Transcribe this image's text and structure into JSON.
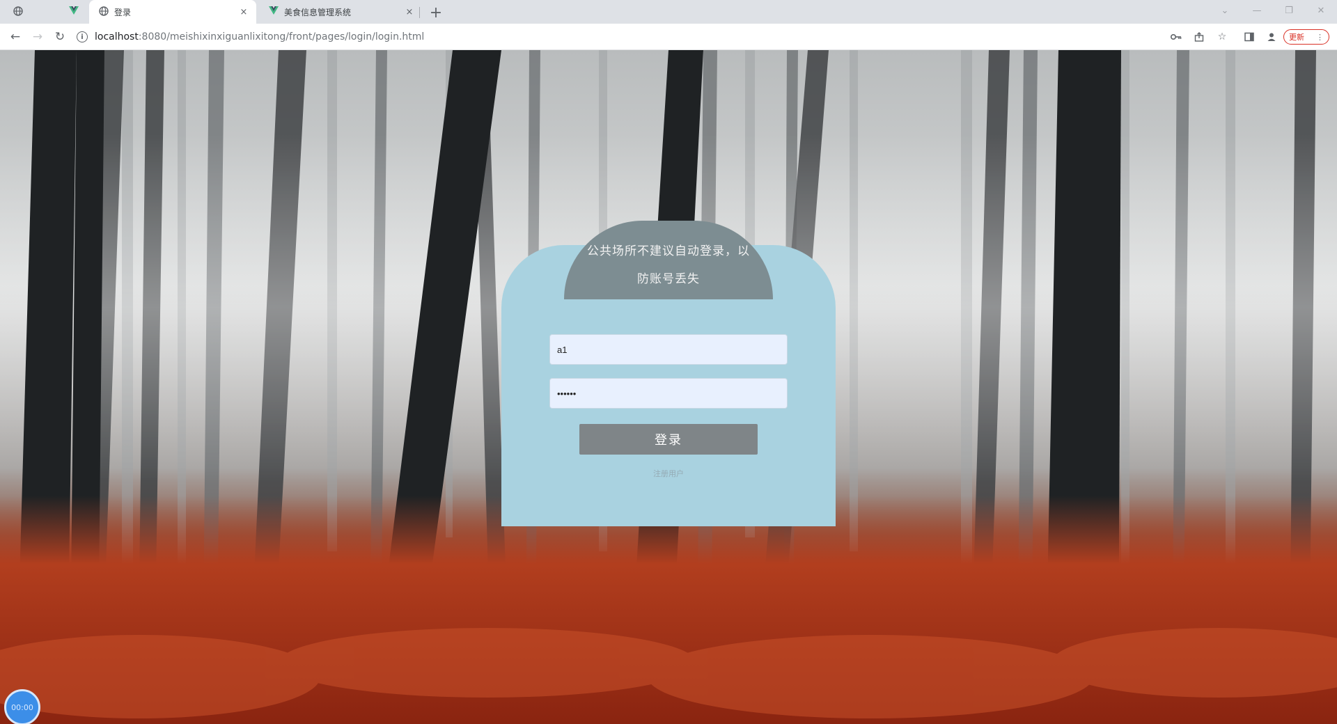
{
  "browser": {
    "tabs": [
      {
        "title": "",
        "pinned": true,
        "icon": "globe-icon"
      },
      {
        "title": "",
        "pinned": true,
        "icon": "blank-icon"
      },
      {
        "title": "",
        "pinned": true,
        "icon": "vue-icon"
      },
      {
        "title": "登录",
        "active": true,
        "icon": "globe-icon"
      },
      {
        "title": "美食信息管理系统",
        "active": false,
        "icon": "vue-icon"
      }
    ],
    "close_glyph": "×",
    "newtab_glyph": "+",
    "address": {
      "host": "localhost",
      "path": ":8080/meishixinxiguanlixitong/front/pages/login/login.html"
    },
    "update_label": "更新",
    "update_menu_glyph": "⋮"
  },
  "login": {
    "notice": "公共场所不建议自动登录，以防账号丢失",
    "username_value": "a1",
    "password_value": "••••••",
    "login_label": "登录",
    "register_label": "注册用户"
  },
  "clock": {
    "label": "00:00"
  },
  "colors": {
    "card_bg": "#a9d2e0",
    "card_head": "#7d8d92",
    "button_bg": "#7f8588",
    "input_bg": "#e8f0fe",
    "accent_red": "#d93025"
  }
}
